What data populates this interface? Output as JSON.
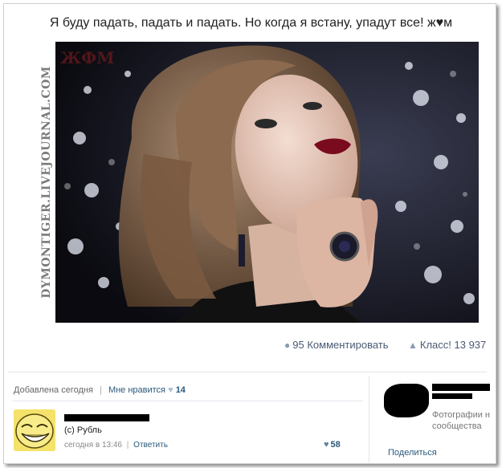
{
  "post": {
    "text": "Я буду падать, падать и падать. Но когда я встану, упадут все! ж♥м"
  },
  "photo": {
    "watermark": "ЖФМ",
    "side_watermark": "DYMONTIGER.LIVEJOURNAL.COM"
  },
  "actions": {
    "comments_count": "95",
    "comment_label": "Комментировать",
    "class_label": "Класс! 13 937"
  },
  "meta": {
    "added": "Добавлена сегодня",
    "separator": "|",
    "dislike_label": "Мне нравится",
    "likes": "14"
  },
  "comment": {
    "text": "(c) Рубль",
    "time": "сегодня в 13:46",
    "separator": "|",
    "reply_label": "Ответить",
    "likes": "58"
  },
  "sidebar": {
    "desc_line1": "Фотографии н",
    "desc_line2": "сообщества",
    "share_label": "Поделиться"
  },
  "colors": {
    "link": "#2b587a",
    "stats_text": "#4a5a74",
    "background": "#ffffff"
  }
}
